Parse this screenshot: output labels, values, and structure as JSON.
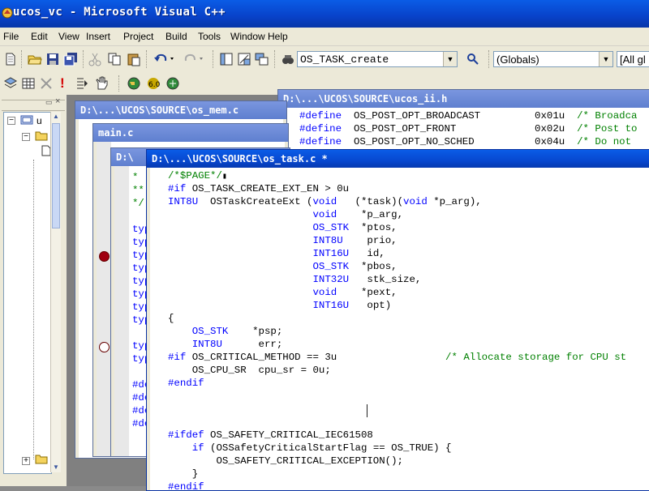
{
  "title": "ucos_vc - Microsoft Visual C++",
  "menu": [
    "File",
    "Edit",
    "View",
    "Insert",
    "Project",
    "Build",
    "Tools",
    "Window",
    "Help"
  ],
  "toolbar": {
    "find_combo": "OS_TASK_create",
    "scope_combo": "(Globals)",
    "members_combo": "[All gl"
  },
  "windows": {
    "ucos_ii_h": {
      "title": "D:\\...\\UCOS\\SOURCE\\ucos_ii.h",
      "lines": [
        {
          "pre": "#define",
          "name": "OS_POST_OPT_BROADCAST",
          "val": "0x01u",
          "cm": "/* Broadca"
        },
        {
          "pre": "#define",
          "name": "OS_POST_OPT_FRONT",
          "val": "0x02u",
          "cm": "/* Post to"
        },
        {
          "pre": "#define",
          "name": "OS_POST_OPT_NO_SCHED",
          "val": "0x04u",
          "cm": "/* Do not"
        }
      ]
    },
    "os_mem_c": {
      "title": "D:\\...\\UCOS\\SOURCE\\os_mem.c",
      "lines": [
        "*",
        "**",
        "*/",
        "",
        "typ",
        "typ",
        "typ",
        "typ",
        "typ",
        "typ",
        "typ",
        "typ",
        "",
        "typ",
        "typ",
        "",
        "#de",
        "#de",
        "#de",
        "#de"
      ]
    },
    "main_c": {
      "title": "main.c"
    },
    "third": {
      "title": "D:\\"
    },
    "os_task_c": {
      "title": "D:\\...\\UCOS\\SOURCE\\os_task.c *",
      "lines": [
        "/*$PAGE*/",
        "#if OS_TASK_CREATE_EXT_EN > 0u",
        "INT8U  OSTaskCreateExt (void   (*task)(void *p_arg),",
        "                        void    *p_arg,",
        "                        OS_STK  *ptos,",
        "                        INT8U    prio,",
        "                        INT16U   id,",
        "                        OS_STK  *pbos,",
        "                        INT32U   stk_size,",
        "                        void    *pext,",
        "                        INT16U   opt)",
        "{",
        "    OS_STK    *psp;",
        "    INT8U      err;",
        "#if OS_CRITICAL_METHOD == 3u                  /* Allocate storage for CPU st",
        "    OS_CPU_SR  cpu_sr = 0u;",
        "#endif",
        "",
        "",
        "",
        "#ifdef OS_SAFETY_CRITICAL_IEC61508",
        "    if (OSSafetyCriticalStartFlag == OS_TRUE) {",
        "        OS_SAFETY_CRITICAL_EXCEPTION();",
        "    }",
        "#endif"
      ]
    }
  },
  "workspace": {
    "root_label": "u"
  },
  "colors": {
    "keyword": "#0000ff",
    "comment": "#008000",
    "caption_active": "#0a5ce6"
  }
}
